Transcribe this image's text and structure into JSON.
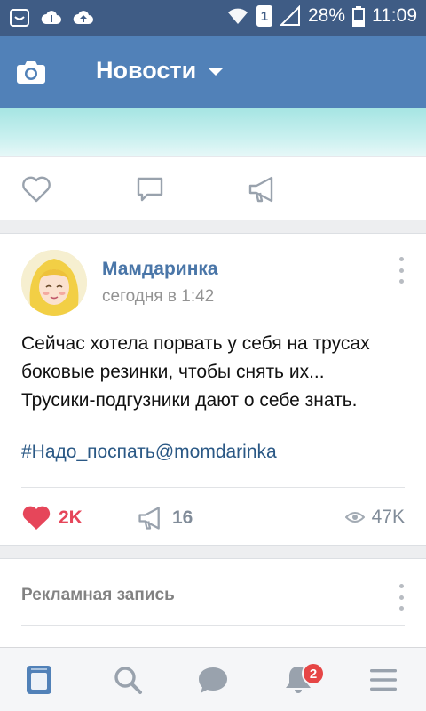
{
  "status_bar": {
    "battery": "28%",
    "time": "11:09",
    "sim_slot": "1",
    "icons": [
      "vk-notification-icon",
      "cloud-warning-icon",
      "cloud-upload-icon",
      "wifi-icon",
      "signal-icon",
      "battery-icon"
    ]
  },
  "app_bar": {
    "title": "Новости",
    "icons": [
      "camera-icon",
      "dropdown-caret-icon"
    ]
  },
  "previous_post": {
    "actions": [
      "like-icon",
      "comment-icon",
      "share-icon"
    ]
  },
  "post": {
    "author": "Мамдаринка",
    "time": "сегодня в 1:42",
    "text_lines": [
      "Сейчас хотела порвать у себя на трусах",
      "боковые резинки, чтобы снять их...",
      "Трусики-подгузники дают о себе знать."
    ],
    "hashtag": "#Надо_поспать@momdarinka",
    "likes": "2K",
    "shares": "16",
    "views": "47K",
    "liked": true
  },
  "ad": {
    "label": "Рекламная запись"
  },
  "bottom_nav": {
    "items": [
      "news-icon",
      "search-icon",
      "messages-icon",
      "notifications-icon",
      "menu-icon"
    ],
    "notifications_badge": "2"
  },
  "colors": {
    "status_bar": "#3f5c85",
    "app_bar": "#5181b8",
    "link": "#2a5885",
    "author": "#4a76a8",
    "like": "#e6465a",
    "badge": "#e64646"
  }
}
